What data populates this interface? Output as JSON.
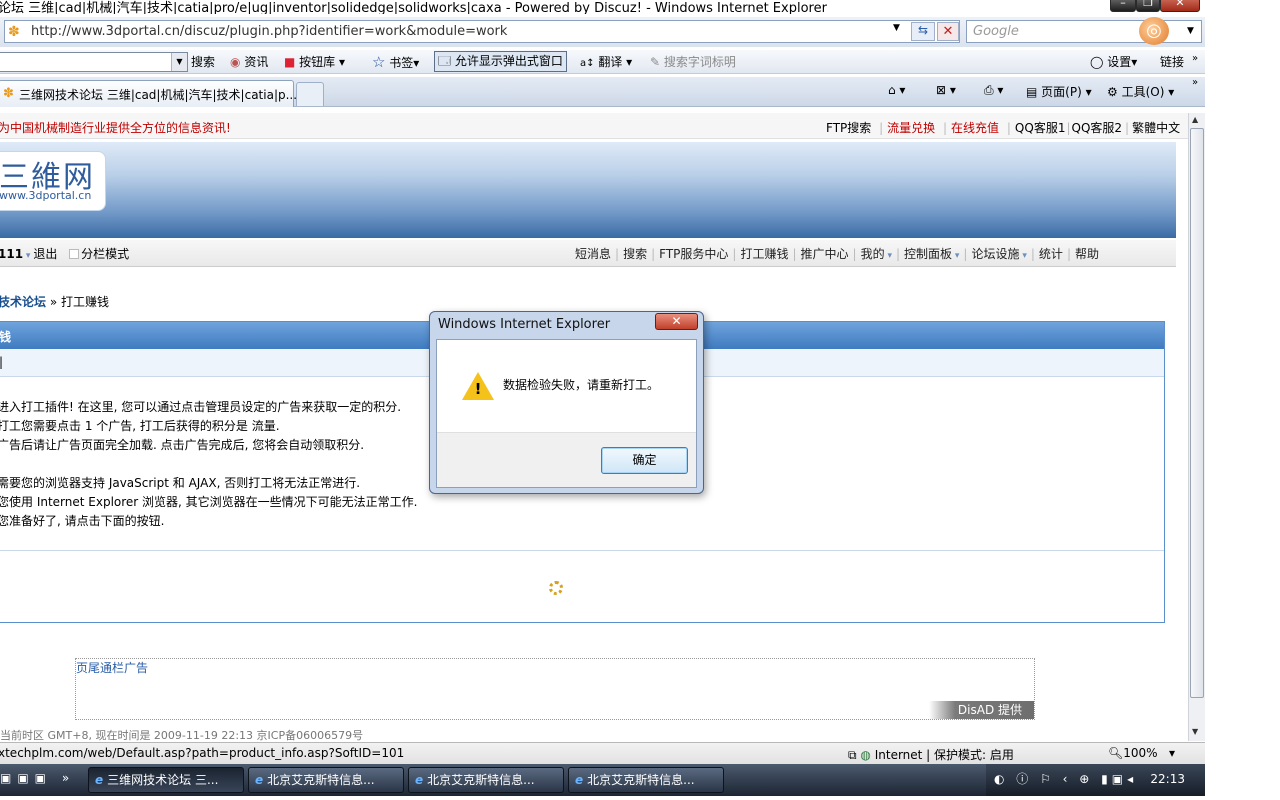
{
  "window": {
    "title": "论坛 三维|cad|机械|汽车|技术|catia|pro/e|ug|inventor|solidedge|solidworks|caxa - Powered by Discuz! - Windows Internet Explorer",
    "minimize": "–",
    "maximize": "❐",
    "close": "✕"
  },
  "address": {
    "url": "http://www.3dportal.cn/discuz/plugin.php?identifier=work&module=work",
    "search_placeholder": "Google"
  },
  "toolbar": {
    "search_label": "搜索",
    "news_label": "资讯",
    "buttons_label": "按钮库",
    "bookmarks_label": "书签",
    "popup_label": "允许显示弹出式窗口",
    "translate_label": "翻译",
    "highlight_label": "搜索字词标明",
    "settings_label": "设置",
    "links_label": "链接"
  },
  "tabs": {
    "active_title": "三维网技术论坛 三维|cad|机械|汽车|技术|catia|p...",
    "page_menu": "页面(P)",
    "tools_menu": "工具(O)"
  },
  "page": {
    "slogan": "为中国机械制造行业提供全方位的信息资讯!",
    "toplinks": {
      "ftp_search": "FTP搜索",
      "traffic": "流量兑换",
      "recharge": "在线充值",
      "qq1": "QQ客服1",
      "qq2": "QQ客服2",
      "traditional": "繁體中文"
    },
    "logo_big": "三維网",
    "logo_small": "www.3dportal.cn",
    "nav_left": {
      "user": "111",
      "logout": "退出",
      "split_mode": "分栏模式"
    },
    "nav_right": [
      "短消息",
      "搜索",
      "FTP服务中心",
      "打工赚钱",
      "推广中心",
      "我的",
      "控制面板",
      "论坛设施",
      "统计",
      "帮助"
    ],
    "breadcrumb": {
      "forum": "技术论坛",
      "current": "» 打工赚钱"
    },
    "box_title": "钱",
    "box_sub": "|",
    "description": [
      "进入打工插件! 在这里, 您可以通过点击管理员设定的广告来获取一定的积分.",
      "打工您需要点击  1 个广告, 打工后获得的积分是  流量.",
      "广告后请让广告页面完全加载. 点击广告完成后, 您将会自动领取积分.",
      "",
      "需要您的浏览器支持  JavaScript 和  AJAX, 否则打工将无法正常进行.",
      "您使用  Internet Explorer 浏览器, 其它浏览器在一些情况下可能无法正常工作.",
      "您准备好了, 请点击下面的按钮."
    ],
    "ad_label": "页尾通栏广告",
    "ad_provider": "DisAD 提供",
    "footer_cut": "当前时区 GMT+8, 现在时间是 2009-11-19 22:13  京ICP备06006579号"
  },
  "status": {
    "text": "xtechplm.com/web/Default.asp?path=product_info.asp?SoftID=101",
    "zone": "Internet | 保护模式: 启用",
    "zoom": "100%"
  },
  "taskbar": {
    "items": [
      "三维网技术论坛 三...",
      "北京艾克斯特信息...",
      "北京艾克斯特信息...",
      "北京艾克斯特信息..."
    ],
    "clock": "22:13"
  },
  "dialog": {
    "title": "Windows Internet Explorer",
    "message": "数据检验失败，请重新打工。",
    "ok": "确定"
  },
  "colors": {
    "accent": "#3f7bc0",
    "slogan_red": "#c00000",
    "warning": "#f5c21b"
  },
  "icons": [
    "page-favicon",
    "refresh-icon",
    "stop-icon",
    "google-search-icon",
    "home-icon",
    "feed-icon",
    "print-icon",
    "page-icon",
    "gear-icon",
    "warning-icon",
    "ie-icon",
    "spinner-icon"
  ]
}
